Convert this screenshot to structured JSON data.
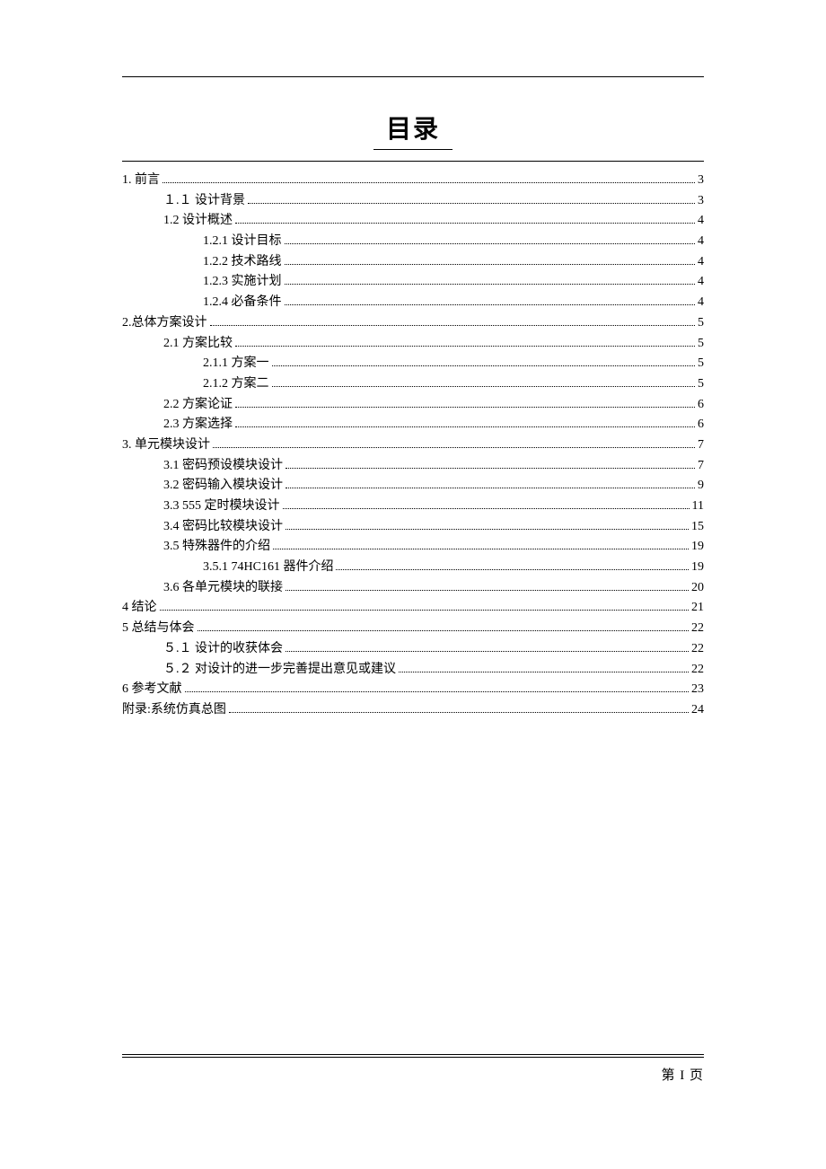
{
  "title": "目录",
  "footer": "第 I 页",
  "toc": [
    {
      "label": "1.   前言",
      "page": "3",
      "indent": 0
    },
    {
      "label": "１.１ 设计背景",
      "page": "3",
      "indent": 1
    },
    {
      "label": "1.2  设计概述",
      "page": "4",
      "indent": 1
    },
    {
      "label": "1.2.1 设计目标",
      "page": "4",
      "indent": 2
    },
    {
      "label": "1.2.2 技术路线",
      "page": "4",
      "indent": 2
    },
    {
      "label": "1.2.3 实施计划",
      "page": "4",
      "indent": 2
    },
    {
      "label": "1.2.4 必备条件",
      "page": "4",
      "indent": 2
    },
    {
      "label": "2.总体方案设计",
      "page": "5",
      "indent": 0
    },
    {
      "label": "2.1 方案比较",
      "page": "5",
      "indent": 1
    },
    {
      "label": "2.1.1 方案一",
      "page": "5",
      "indent": 2
    },
    {
      "label": "2.1.2 方案二",
      "page": "5",
      "indent": 2
    },
    {
      "label": "2.2 方案论证",
      "page": "6",
      "indent": 1
    },
    {
      "label": "2.3 方案选择",
      "page": "6",
      "indent": 1
    },
    {
      "label": "3. 单元模块设计",
      "page": "7",
      "indent": 0
    },
    {
      "label": "3.1 密码预设模块设计",
      "page": "7",
      "indent": 1
    },
    {
      "label": "3.2 密码输入模块设计",
      "page": "9",
      "indent": 1
    },
    {
      "label": "3.3 555 定时模块设计",
      "page": "11",
      "indent": 1
    },
    {
      "label": "3.4  密码比较模块设计",
      "page": "15",
      "indent": 1
    },
    {
      "label": "3.5 特殊器件的介绍",
      "page": "19",
      "indent": 1
    },
    {
      "label": "3.5.1 74HC161 器件介绍",
      "page": "19",
      "indent": 2
    },
    {
      "label": "3.6  各单元模块的联接",
      "page": "20",
      "indent": 1
    },
    {
      "label": "4 结论",
      "page": "21",
      "indent": 0
    },
    {
      "label": "5 总结与体会",
      "page": "22",
      "indent": 0
    },
    {
      "label": "５.１ 设计的收获体会",
      "page": "22",
      "indent": 1
    },
    {
      "label": "５.２ 对设计的进一步完善提出意见或建议",
      "page": "22",
      "indent": 1
    },
    {
      "label": "6 参考文献",
      "page": "23",
      "indent": 0
    },
    {
      "label": "附录:系统仿真总图",
      "page": "24",
      "indent": 0
    }
  ]
}
